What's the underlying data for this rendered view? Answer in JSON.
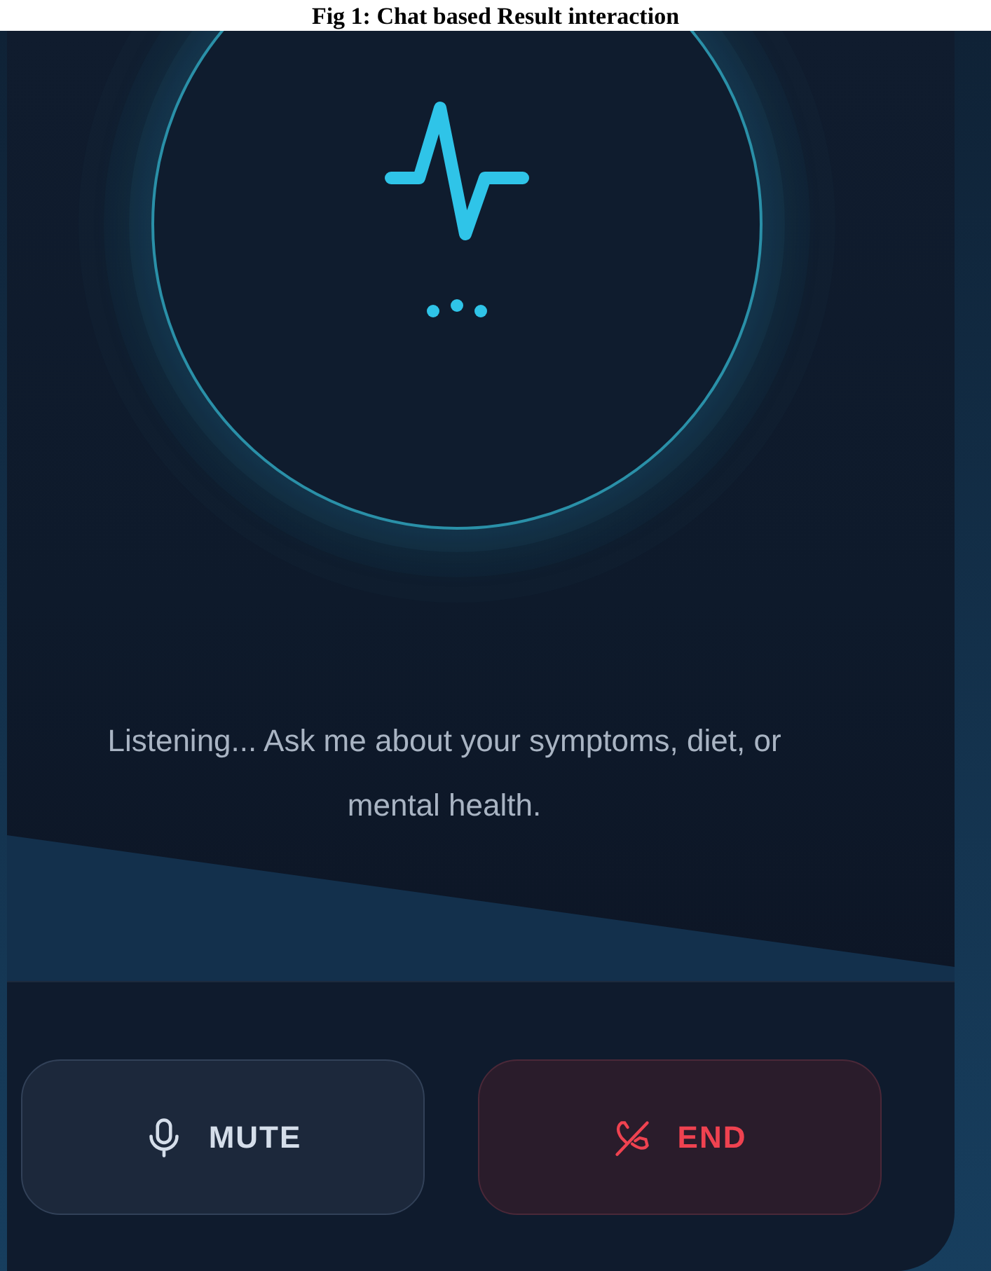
{
  "caption": "Fig 1: Chat based Result interaction",
  "status_text": "Listening... Ask me about your symptoms, diet, or mental health.",
  "buttons": [
    {
      "label": "MUTE",
      "kind": "mute"
    },
    {
      "label": "END",
      "kind": "end"
    }
  ]
}
